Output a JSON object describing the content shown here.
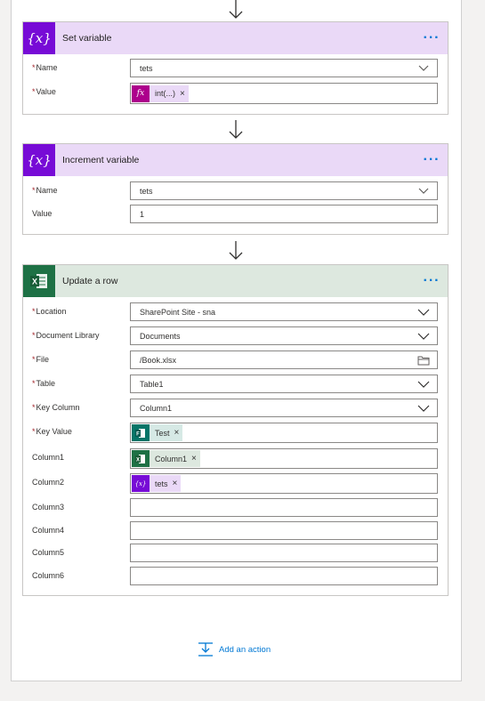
{
  "set_variable": {
    "title": "Set variable",
    "menu": "···",
    "fields": [
      {
        "label": "Name",
        "required": true,
        "value": ""
      },
      {
        "label": "Value",
        "required": true,
        "value": ""
      }
    ],
    "name_value": "tets",
    "value_token": "int(...)",
    "token_remove": "×",
    "icon": "{x}"
  },
  "increment_variable": {
    "title": "Increment variable",
    "menu": "···",
    "name_label": "Name",
    "name_value": "tets",
    "value_label": "Value",
    "value_value": "1",
    "icon": "{x}"
  },
  "update_row": {
    "title": "Update a row",
    "menu": "···",
    "location_label": "Location",
    "location_value": "SharePoint Site - sna",
    "doclib_label": "Document Library",
    "doclib_value": "Documents",
    "file_label": "File",
    "file_value": "/Book.xlsx",
    "table_label": "Table",
    "table_value": "Table1",
    "keycol_label": "Key Column",
    "keycol_value": "Column1",
    "keyval_label": "Key Value",
    "keyval_token": "Test",
    "col1_label": "Column1",
    "col1_token": "Column1",
    "col2_label": "Column2",
    "col2_token": "tets",
    "col3_label": "Column3",
    "col4_label": "Column4",
    "col5_label": "Column5",
    "col6_label": "Column6",
    "required_mark": "*",
    "token_remove": "×"
  },
  "add_action": {
    "label": "Add an action"
  },
  "colors": {
    "variable": "#770bd6",
    "excel": "#1e7145",
    "forms": "#077568",
    "link": "#0078d4",
    "required": "#a4262c"
  }
}
